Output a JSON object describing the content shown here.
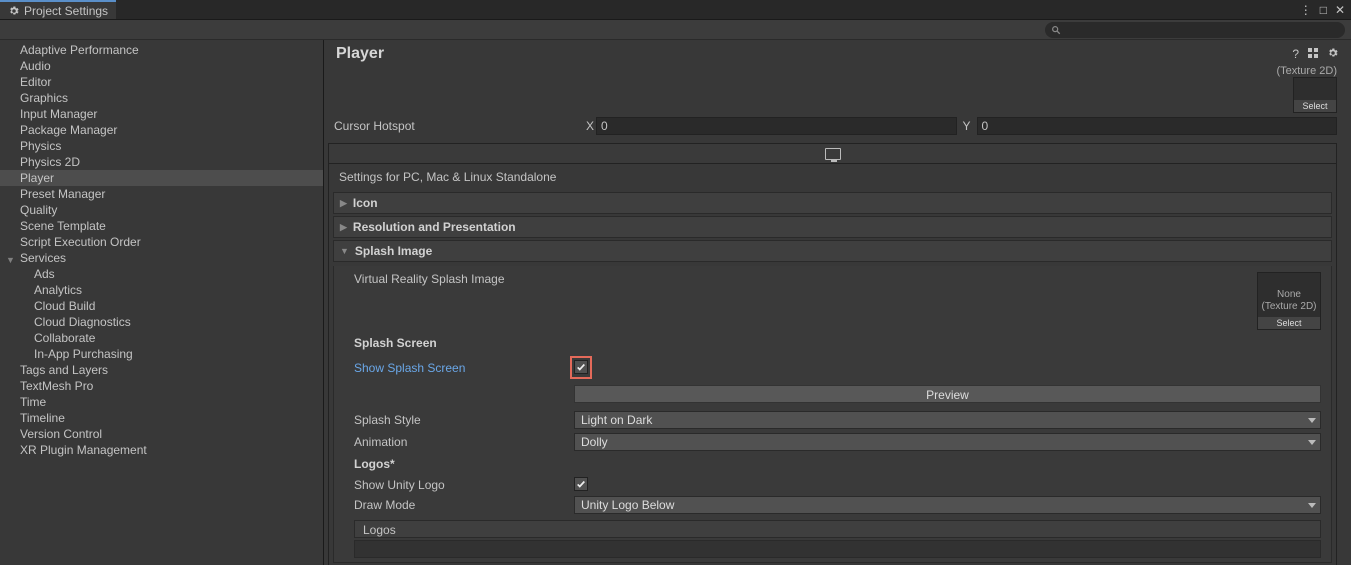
{
  "window": {
    "tab_title": "Project Settings"
  },
  "sidebar": {
    "items": [
      "Adaptive Performance",
      "Audio",
      "Editor",
      "Graphics",
      "Input Manager",
      "Package Manager",
      "Physics",
      "Physics 2D",
      "Player",
      "Preset Manager",
      "Quality",
      "Scene Template",
      "Script Execution Order",
      "Services"
    ],
    "services": [
      "Ads",
      "Analytics",
      "Cloud Build",
      "Cloud Diagnostics",
      "Collaborate",
      "In-App Purchasing"
    ],
    "items_after": [
      "Tags and Layers",
      "TextMesh Pro",
      "Time",
      "Timeline",
      "Version Control",
      "XR Plugin Management"
    ]
  },
  "page": {
    "title": "Player",
    "texture_type_hint": "(Texture 2D)",
    "select_label": "Select",
    "cursor_hotspot_label": "Cursor Hotspot",
    "x_label": "X",
    "x_value": "0",
    "y_label": "Y",
    "y_value": "0",
    "platform_heading": "Settings for PC, Mac & Linux Standalone",
    "sections": {
      "icon": "Icon",
      "resolution": "Resolution and Presentation",
      "splash": "Splash Image"
    },
    "splash": {
      "vr_label": "Virtual Reality Splash Image",
      "none_label": "None",
      "tex2d_label": "(Texture 2D)",
      "screen_heading": "Splash Screen",
      "show_label": "Show Splash Screen",
      "preview_label": "Preview",
      "style_label": "Splash Style",
      "style_value": "Light on Dark",
      "anim_label": "Animation",
      "anim_value": "Dolly",
      "logos_heading": "Logos*",
      "show_unity_label": "Show Unity Logo",
      "draw_mode_label": "Draw Mode",
      "draw_mode_value": "Unity Logo Below",
      "logos_label": "Logos"
    }
  }
}
